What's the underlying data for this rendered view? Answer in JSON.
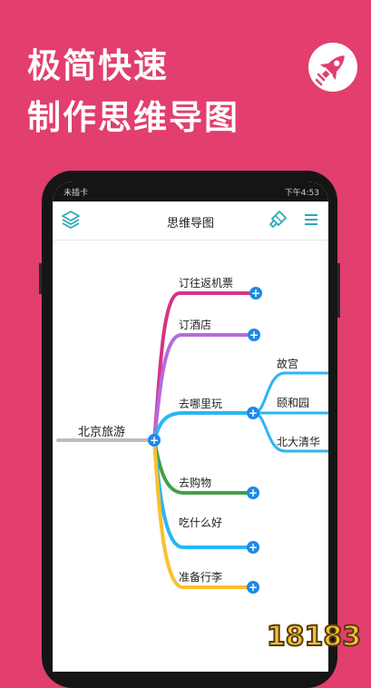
{
  "headline": {
    "line1": "极简快速",
    "line2": "制作思维导图"
  },
  "statusbar": {
    "left": "未插卡",
    "right": "下午4:53"
  },
  "app": {
    "title": "思维导图"
  },
  "mindmap": {
    "root": "北京旅游",
    "branches": [
      "订往返机票",
      "订酒店",
      "去哪里玩",
      "去购物",
      "吃什么好",
      "准备行李"
    ],
    "sub": [
      "故宫",
      "颐和园",
      "北大清华"
    ],
    "plus_glyph": "+"
  },
  "watermark": "18183",
  "colors": {
    "background": "#e23e6e",
    "accent": "#2aa9b6",
    "node_plus": "#1e88e5"
  }
}
